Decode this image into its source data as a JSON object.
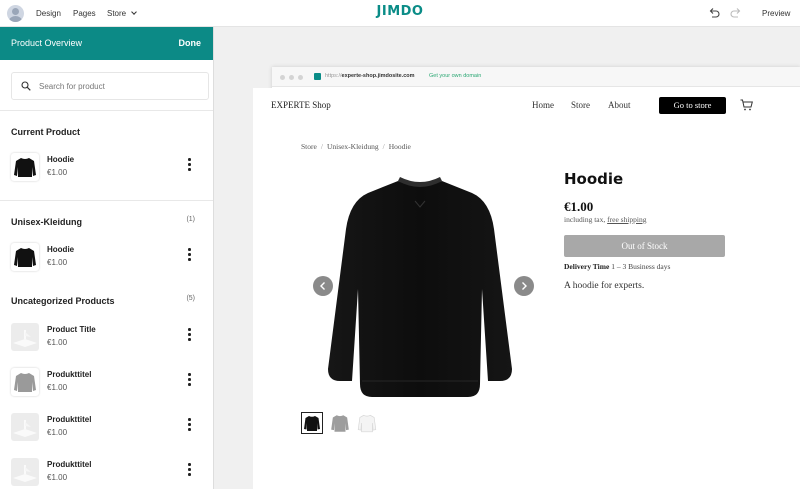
{
  "topbar": {
    "nav": [
      "Design",
      "Pages",
      "Store"
    ],
    "logo": "JIMDO",
    "preview": "Preview"
  },
  "sidebar": {
    "title": "Product Overview",
    "done": "Done",
    "search_placeholder": "Search for product",
    "sections": [
      {
        "title": "Current Product",
        "count": "",
        "items": [
          {
            "name": "Hoodie",
            "price": "€1.00",
            "thumb": "black-sweater"
          }
        ]
      },
      {
        "title": "Unisex-Kleidung",
        "count": "(1)",
        "items": [
          {
            "name": "Hoodie",
            "price": "€1.00",
            "thumb": "black-sweater"
          }
        ]
      },
      {
        "title": "Uncategorized Products",
        "count": "(5)",
        "items": [
          {
            "name": "Product Title",
            "price": "€1.00",
            "thumb": "placeholder"
          },
          {
            "name": "Produkttitel",
            "price": "€1.00",
            "thumb": "grey-sweater"
          },
          {
            "name": "Produkttitel",
            "price": "€1.00",
            "thumb": "placeholder"
          },
          {
            "name": "Produkttitel",
            "price": "€1.00",
            "thumb": "placeholder"
          }
        ]
      }
    ]
  },
  "browser": {
    "url_protocol": "https://",
    "url_domain": "experte-shop.jimdosite.com",
    "own_domain": "Get your own domain"
  },
  "site": {
    "shop_name": "EXPERTE Shop",
    "nav": [
      "Home",
      "Store",
      "About"
    ],
    "goto_store": "Go to store",
    "breadcrumb": [
      "Store",
      "Unisex-Kleidung",
      "Hoodie"
    ],
    "product": {
      "title": "Hoodie",
      "price": "€1.00",
      "tax_note": "including tax,",
      "shipping": "free shipping",
      "stock_button": "Out of Stock",
      "delivery_label": "Delivery Time",
      "delivery_value": "1 – 3 Business days",
      "description": "A hoodie for experts."
    }
  },
  "colors": {
    "brand": "#0c8a86",
    "logo": "#0a8c87",
    "button_dark": "#000000",
    "button_disabled": "#a8a8a8"
  }
}
